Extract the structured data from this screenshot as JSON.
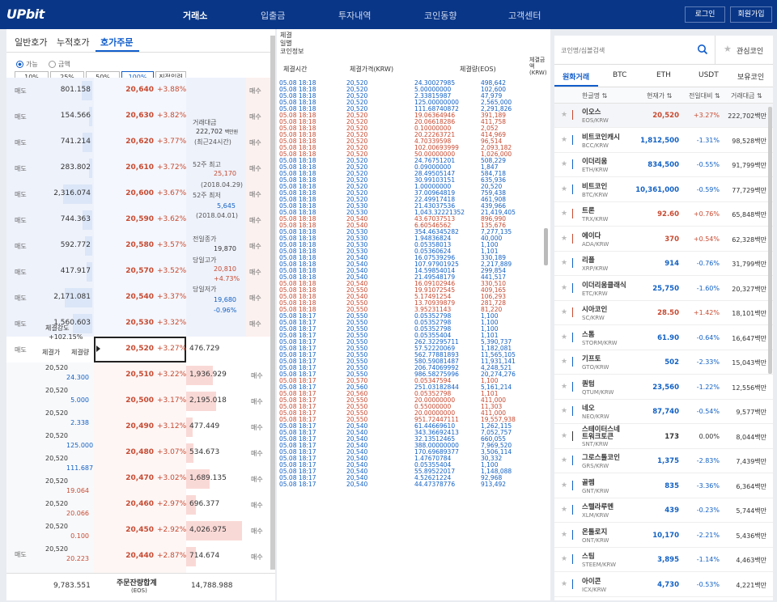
{
  "header": {
    "logo": "UPbit",
    "nav": [
      "거래소",
      "입출금",
      "투자내역",
      "코인동향",
      "고객센터"
    ],
    "login": "로그인",
    "signup": "회원가입"
  },
  "orderbook": {
    "tabs": [
      "일반호가",
      "누적호가",
      "호가주문"
    ],
    "opt_possible": "가능",
    "opt_amount": "금액",
    "pct_buttons": [
      "10%",
      "25%",
      "50%",
      "100%",
      "직접입력"
    ],
    "side_ask": "매도",
    "side_bid": "매수",
    "asks": [
      {
        "qty": "801.158",
        "price": "20,640",
        "chg": "+3.88%"
      },
      {
        "qty": "154.566",
        "price": "20,630",
        "chg": "+3.82%"
      },
      {
        "qty": "741.214",
        "price": "20,620",
        "chg": "+3.77%"
      },
      {
        "qty": "283.802",
        "price": "20,610",
        "chg": "+3.72%"
      },
      {
        "qty": "2,316.074",
        "price": "20,600",
        "chg": "+3.67%"
      },
      {
        "qty": "744.363",
        "price": "20,590",
        "chg": "+3.62%"
      },
      {
        "qty": "592.772",
        "price": "20,580",
        "chg": "+3.57%"
      },
      {
        "qty": "417.917",
        "price": "20,570",
        "chg": "+3.52%"
      },
      {
        "qty": "2,171.081",
        "price": "20,540",
        "chg": "+3.37%"
      },
      {
        "qty": "1,560.603",
        "price": "20,530",
        "chg": "+3.32%"
      },
      {
        "qty": "",
        "price": "20,520",
        "chg": "+3.27%"
      }
    ],
    "bids": [
      {
        "price": "20,510",
        "chg": "+3.22%",
        "qty": "1,936.929"
      },
      {
        "price": "20,500",
        "chg": "+3.17%",
        "qty": "2,195.018"
      },
      {
        "price": "20,490",
        "chg": "+3.12%",
        "qty": "477.449"
      },
      {
        "price": "20,480",
        "chg": "+3.07%",
        "qty": "534.673"
      },
      {
        "price": "20,470",
        "chg": "+3.02%",
        "qty": "1,689.135"
      },
      {
        "price": "20,460",
        "chg": "+2.97%",
        "qty": "696.377"
      },
      {
        "price": "20,450",
        "chg": "+2.92%",
        "qty": "4,026.975"
      },
      {
        "price": "20,440",
        "chg": "+2.87%",
        "qty": "714.674"
      },
      {
        "price": "20,430",
        "chg": "+2.82%",
        "qty": "2,041.030"
      }
    ],
    "current_right_qty": "476.729",
    "strength_label": "체결강도",
    "strength_value": "+102.15%",
    "mini_headers": [
      "체결가",
      "체결량"
    ],
    "mini_trades": [
      {
        "p": "20,520",
        "q": "24.300"
      },
      {
        "p": "20,520",
        "q": "5.000"
      },
      {
        "p": "20,520",
        "q": "2.338"
      },
      {
        "p": "20,520",
        "q": "125.000"
      },
      {
        "p": "20,520",
        "q": "111.687"
      },
      {
        "p": "20,520",
        "q": "19.064"
      },
      {
        "p": "20,520",
        "q": "20.066"
      },
      {
        "p": "20,520",
        "q": "0.100"
      },
      {
        "p": "20,520",
        "q": "20.223"
      }
    ],
    "info": {
      "vol_label": "거래대금",
      "vol_value": "222,702",
      "vol_unit": "백만원",
      "vol_period": "(최근24시간)",
      "w52_high_label": "52주 최고",
      "w52_high": "25,170",
      "w52_high_date": "(2018.04.29)",
      "w52_low_label": "52주 최저",
      "w52_low": "5,645",
      "w52_low_date": "(2018.04.01)",
      "prev_close_label": "전일종가",
      "prev_close": "19,870",
      "high_label": "당일고가",
      "high": "20,810",
      "high_pct": "+4.73%",
      "low_label": "당일저가",
      "low": "19,680",
      "low_pct": "-0.96%"
    },
    "footer_ask_total": "9,783.551",
    "footer_label": "주문잔량합계",
    "footer_unit": "(EOS)",
    "footer_bid_total": "14,788.988"
  },
  "trades": {
    "tabs": [
      "체결",
      "일별",
      "코인정보"
    ],
    "headers": [
      "체결시간",
      "체결가격(KRW)",
      "체결량(EOS)",
      "체결금액(KRW)"
    ],
    "rows": [
      [
        "05.08 18:18",
        "20,520",
        "24.30027985",
        "498,642",
        "b"
      ],
      [
        "05.08 18:18",
        "20,520",
        "5.00000000",
        "102,600",
        "b"
      ],
      [
        "05.08 18:18",
        "20,520",
        "2.33815987",
        "47,979",
        "b"
      ],
      [
        "05.08 18:18",
        "20,520",
        "125.00000000",
        "2,565,000",
        "b"
      ],
      [
        "05.08 18:18",
        "20,520",
        "111.68740872",
        "2,291,826",
        "b"
      ],
      [
        "05.08 18:18",
        "20,520",
        "19.06364946",
        "391,189",
        "r"
      ],
      [
        "05.08 18:18",
        "20,520",
        "20.06618286",
        "411,758",
        "r"
      ],
      [
        "05.08 18:18",
        "20,520",
        "0.10000000",
        "2,052",
        "r"
      ],
      [
        "05.08 18:18",
        "20,520",
        "20.22263721",
        "414,969",
        "r"
      ],
      [
        "05.08 18:18",
        "20,520",
        "4.70339598",
        "96,514",
        "r"
      ],
      [
        "05.08 18:18",
        "20,520",
        "102.00693999",
        "2,093,182",
        "r"
      ],
      [
        "05.08 18:18",
        "20,520",
        "50.00000000",
        "1,026,000",
        "r"
      ],
      [
        "05.08 18:18",
        "20,520",
        "24.76751201",
        "508,229",
        "b"
      ],
      [
        "05.08 18:18",
        "20,520",
        "0.09000000",
        "1,847",
        "b"
      ],
      [
        "05.08 18:18",
        "20,520",
        "28.49505147",
        "584,718",
        "b"
      ],
      [
        "05.08 18:18",
        "20,520",
        "30.99103151",
        "635,936",
        "b"
      ],
      [
        "05.08 18:18",
        "20,520",
        "1.00000000",
        "20,520",
        "b"
      ],
      [
        "05.08 18:18",
        "20,520",
        "37.00964819",
        "759,438",
        "b"
      ],
      [
        "05.08 18:18",
        "20,520",
        "22.49917418",
        "461,908",
        "b"
      ],
      [
        "05.08 18:18",
        "20,530",
        "21.43037536",
        "439,966",
        "b"
      ],
      [
        "05.08 18:18",
        "20,530",
        "1,043.32221352",
        "21,419,405",
        "b"
      ],
      [
        "05.08 18:18",
        "20,540",
        "43.67037513",
        "896,990",
        "r"
      ],
      [
        "05.08 18:18",
        "20,540",
        "6.60546562",
        "135,676",
        "r"
      ],
      [
        "05.08 18:18",
        "20,530",
        "354.46345282",
        "7,277,135",
        "b"
      ],
      [
        "05.08 18:18",
        "20,530",
        "1.94836824",
        "40,000",
        "b"
      ],
      [
        "05.08 18:18",
        "20,530",
        "0.05358013",
        "1,100",
        "b"
      ],
      [
        "05.08 18:18",
        "20,530",
        "0.05360624",
        "1,101",
        "b"
      ],
      [
        "05.08 18:18",
        "20,540",
        "16.07539296",
        "330,189",
        "b"
      ],
      [
        "05.08 18:18",
        "20,540",
        "107.97901925",
        "2,217,889",
        "b"
      ],
      [
        "05.08 18:18",
        "20,540",
        "14.59854014",
        "299,854",
        "b"
      ],
      [
        "05.08 18:18",
        "20,540",
        "21.49548179",
        "441,517",
        "b"
      ],
      [
        "05.08 18:18",
        "20,540",
        "16.09102946",
        "330,510",
        "r"
      ],
      [
        "05.08 18:18",
        "20,550",
        "19.91072545",
        "409,165",
        "r"
      ],
      [
        "05.08 18:18",
        "20,540",
        "5.17491254",
        "106,293",
        "r"
      ],
      [
        "05.08 18:18",
        "20,550",
        "13.70939879",
        "281,728",
        "r"
      ],
      [
        "05.08 18:18",
        "20,550",
        "3.95231143",
        "81,220",
        "r"
      ],
      [
        "05.08 18:17",
        "20,550",
        "0.05352798",
        "1,100",
        "b"
      ],
      [
        "05.08 18:17",
        "20,550",
        "0.05352798",
        "1,100",
        "b"
      ],
      [
        "05.08 18:17",
        "20,550",
        "0.05352798",
        "1,100",
        "b"
      ],
      [
        "05.08 18:17",
        "20,550",
        "0.05355404",
        "1,101",
        "b"
      ],
      [
        "05.08 18:17",
        "20,550",
        "262.32295711",
        "5,390,737",
        "b"
      ],
      [
        "05.08 18:17",
        "20,550",
        "57.52220069",
        "1,182,081",
        "b"
      ],
      [
        "05.08 18:17",
        "20,550",
        "562.77881893",
        "11,565,105",
        "b"
      ],
      [
        "05.08 18:17",
        "20,550",
        "580.59081487",
        "11,931,141",
        "b"
      ],
      [
        "05.08 18:17",
        "20,550",
        "206.74069992",
        "4,248,521",
        "b"
      ],
      [
        "05.08 18:17",
        "20,550",
        "986.58275996",
        "20,274,276",
        "b"
      ],
      [
        "05.08 18:17",
        "20,570",
        "0.05347594",
        "1,100",
        "r"
      ],
      [
        "05.08 18:17",
        "20,560",
        "251.03182844",
        "5,161,214",
        "b"
      ],
      [
        "05.08 18:17",
        "20,560",
        "0.05352798",
        "1,101",
        "r"
      ],
      [
        "05.08 18:17",
        "20,550",
        "20.00000000",
        "411,000",
        "r"
      ],
      [
        "05.08 18:17",
        "20,550",
        "0.55000000",
        "11,303",
        "r"
      ],
      [
        "05.08 18:17",
        "20,550",
        "20.00000000",
        "411,000",
        "r"
      ],
      [
        "05.08 18:17",
        "20,550",
        "951.72447111",
        "19,557,938",
        "r"
      ],
      [
        "05.08 18:17",
        "20,540",
        "61.44669610",
        "1,262,115",
        "b"
      ],
      [
        "05.08 18:17",
        "20,540",
        "343.36692413",
        "7,052,757",
        "b"
      ],
      [
        "05.08 18:17",
        "20,540",
        "32.13512465",
        "660,055",
        "b"
      ],
      [
        "05.08 18:17",
        "20,540",
        "388.00000000",
        "7,969,520",
        "b"
      ],
      [
        "05.08 18:17",
        "20,540",
        "170.69689377",
        "3,506,114",
        "b"
      ],
      [
        "05.08 18:17",
        "20,540",
        "1.47670784",
        "30,332",
        "b"
      ],
      [
        "05.08 18:17",
        "20,540",
        "0.05355404",
        "1,100",
        "b"
      ],
      [
        "05.08 18:17",
        "20,540",
        "55.89522017",
        "1,148,088",
        "b"
      ],
      [
        "05.08 18:17",
        "20,540",
        "4.52621224",
        "92,968",
        "b"
      ],
      [
        "05.08 18:17",
        "20,540",
        "44.47378776",
        "913,492",
        "b"
      ]
    ]
  },
  "market": {
    "search_placeholder": "코인명/심볼검색",
    "favorites": "관심코인",
    "tabs": [
      "원화거래",
      "BTC",
      "ETH",
      "USDT",
      "보유코인"
    ],
    "headers": [
      "한글명",
      "현재가",
      "전일대비",
      "거래대금"
    ],
    "coins": [
      {
        "name": "이오스",
        "tick": "EOS/KRW",
        "price": "20,520",
        "chg": "+3.27%",
        "vol": "222,702백만",
        "dir": "up"
      },
      {
        "name": "비트코인캐시",
        "tick": "BCC/KRW",
        "price": "1,812,500",
        "chg": "-1.31%",
        "vol": "98,528백만",
        "dir": "dn"
      },
      {
        "name": "이더리움",
        "tick": "ETH/KRW",
        "price": "834,500",
        "chg": "-0.55%",
        "vol": "91,799백만",
        "dir": "dn"
      },
      {
        "name": "비트코인",
        "tick": "BTC/KRW",
        "price": "10,361,000",
        "chg": "-0.59%",
        "vol": "77,729백만",
        "dir": "dn"
      },
      {
        "name": "트론",
        "tick": "TRX/KRW",
        "price": "92.60",
        "chg": "+0.76%",
        "vol": "65,848백만",
        "dir": "up"
      },
      {
        "name": "에이다",
        "tick": "ADA/KRW",
        "price": "370",
        "chg": "+0.54%",
        "vol": "62,328백만",
        "dir": "up"
      },
      {
        "name": "리플",
        "tick": "XRP/KRW",
        "price": "914",
        "chg": "-0.76%",
        "vol": "31,799백만",
        "dir": "dn"
      },
      {
        "name": "이더리움클래식",
        "tick": "ETC/KRW",
        "price": "25,750",
        "chg": "-1.60%",
        "vol": "20,327백만",
        "dir": "dn"
      },
      {
        "name": "시아코인",
        "tick": "SC/KRW",
        "price": "28.50",
        "chg": "+1.42%",
        "vol": "18,101백만",
        "dir": "up"
      },
      {
        "name": "스톰",
        "tick": "STORM/KRW",
        "price": "61.90",
        "chg": "-0.64%",
        "vol": "16,647백만",
        "dir": "dn"
      },
      {
        "name": "기프토",
        "tick": "GTO/KRW",
        "price": "502",
        "chg": "-2.33%",
        "vol": "15,043백만",
        "dir": "dn"
      },
      {
        "name": "퀀텀",
        "tick": "QTUM/KRW",
        "price": "23,560",
        "chg": "-1.22%",
        "vol": "12,556백만",
        "dir": "dn"
      },
      {
        "name": "네오",
        "tick": "NEO/KRW",
        "price": "87,740",
        "chg": "-0.54%",
        "vol": "9,577백만",
        "dir": "dn"
      },
      {
        "name": "스테이터스네트워크토큰",
        "tick": "SNT/KRW",
        "price": "173",
        "chg": "0.00%",
        "vol": "8,044백만",
        "dir": "eq"
      },
      {
        "name": "그로스톨코인",
        "tick": "GRS/KRW",
        "price": "1,375",
        "chg": "-2.83%",
        "vol": "7,439백만",
        "dir": "dn"
      },
      {
        "name": "골렘",
        "tick": "GNT/KRW",
        "price": "835",
        "chg": "-3.36%",
        "vol": "6,364백만",
        "dir": "dn"
      },
      {
        "name": "스텔라루멘",
        "tick": "XLM/KRW",
        "price": "439",
        "chg": "-0.23%",
        "vol": "5,744백만",
        "dir": "dn"
      },
      {
        "name": "온톨로지",
        "tick": "ONT/KRW",
        "price": "10,170",
        "chg": "-2.21%",
        "vol": "5,436백만",
        "dir": "dn"
      },
      {
        "name": "스팀",
        "tick": "STEEM/KRW",
        "price": "3,895",
        "chg": "-1.14%",
        "vol": "4,463백만",
        "dir": "dn"
      },
      {
        "name": "아이콘",
        "tick": "ICX/KRW",
        "price": "4,730",
        "chg": "-0.53%",
        "vol": "4,221백만",
        "dir": "dn"
      }
    ]
  },
  "colors": {
    "brand": "#093687",
    "up": "#c84a31",
    "down": "#1261c4"
  }
}
